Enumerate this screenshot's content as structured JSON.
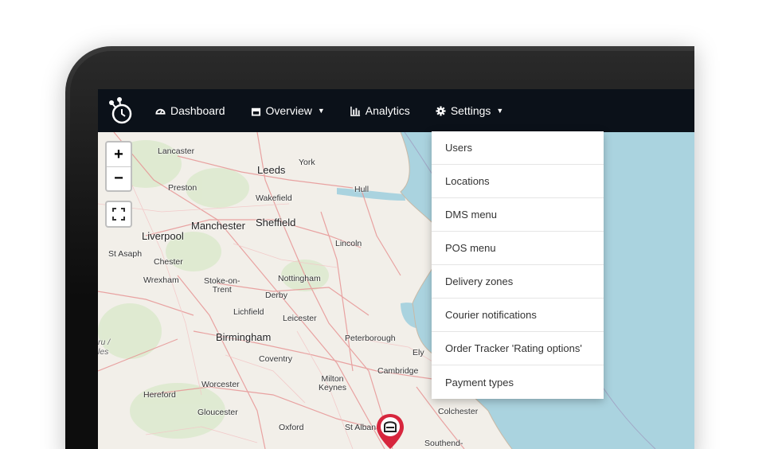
{
  "navbar": {
    "logo_icon": "stopwatch-logo-icon",
    "items": [
      {
        "label": "Dashboard",
        "icon": "gauge-icon"
      },
      {
        "label": "Overview",
        "icon": "box-icon"
      },
      {
        "label": "Analytics",
        "icon": "bar-chart-icon"
      },
      {
        "label": "Settings",
        "icon": "gear-icon"
      }
    ]
  },
  "settings_menu": {
    "items": [
      "Users",
      "Locations",
      "DMS menu",
      "POS menu",
      "Delivery zones",
      "Courier notifications",
      "Order Tracker 'Rating options'",
      "Payment types"
    ]
  },
  "map": {
    "zoom_in": "+",
    "zoom_out": "−",
    "cities": {
      "lancaster": "Lancaster",
      "leeds": "Leeds",
      "york": "York",
      "preston": "Preston",
      "hull": "Hull",
      "wakefield": "Wakefield",
      "manchester": "Manchester",
      "sheffield": "Sheffield",
      "liverpool": "Liverpool",
      "lincoln": "Lincoln",
      "st_asaph": "St Asaph",
      "chester": "Chester",
      "wrexham": "Wrexham",
      "stoke": "Stoke-on-\nTrent",
      "nottingham": "Nottingham",
      "derby": "Derby",
      "lichfield": "Lichfield",
      "leicester": "Leicester",
      "birmingham": "Birmingham",
      "peterborough": "Peterborough",
      "ely": "Ely",
      "coventry": "Coventry",
      "cambridge": "Cambridge",
      "worcester": "Worcester",
      "milton_keynes": "Milton\nKeynes",
      "hereford": "Hereford",
      "gloucester": "Gloucester",
      "colchester": "Colchester",
      "oxford": "Oxford",
      "st_albans": "St Alban",
      "southend": "Southend-",
      "wales_a": "ru /",
      "wales_b": "les"
    },
    "colors": {
      "sea": "#aad3df",
      "land": "#f2efe9",
      "roads": "#e8a0a0",
      "marker": "#d7263d"
    },
    "marker_icon": "store-pin-icon"
  }
}
